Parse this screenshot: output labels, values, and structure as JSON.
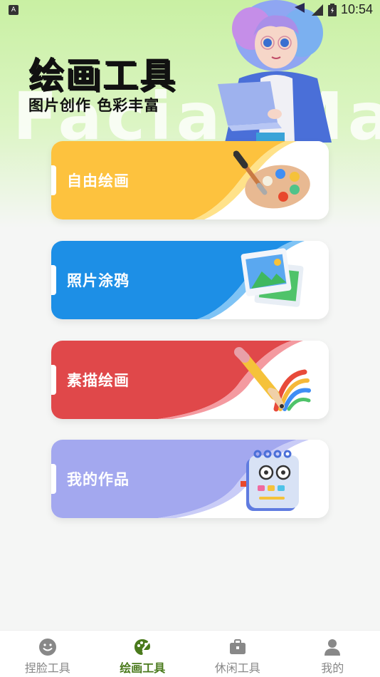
{
  "status_bar": {
    "time": "10:54",
    "indicator": "A"
  },
  "hero": {
    "title": "绘画工具",
    "subtitle": "图片创作 色彩丰富",
    "background_word": "Facial Mac"
  },
  "cards": [
    {
      "label": "自由绘画",
      "color": "#fdc23e",
      "icon": "paint-palette-icon"
    },
    {
      "label": "照片涂鸦",
      "color": "#1d8fe6",
      "icon": "photo-icon"
    },
    {
      "label": "素描绘画",
      "color": "#e0484a",
      "icon": "pencil-icon"
    },
    {
      "label": "我的作品",
      "color": "#a3a8ef",
      "icon": "notebook-icon"
    }
  ],
  "nav": {
    "items": [
      {
        "label": "捏脸工具",
        "icon": "smile-icon",
        "active": false
      },
      {
        "label": "绘画工具",
        "icon": "palette-icon",
        "active": true
      },
      {
        "label": "休闲工具",
        "icon": "briefcase-icon",
        "active": false
      },
      {
        "label": "我的",
        "icon": "person-icon",
        "active": false
      }
    ],
    "active_color": "#4a7a1c",
    "inactive_color": "#888888"
  }
}
